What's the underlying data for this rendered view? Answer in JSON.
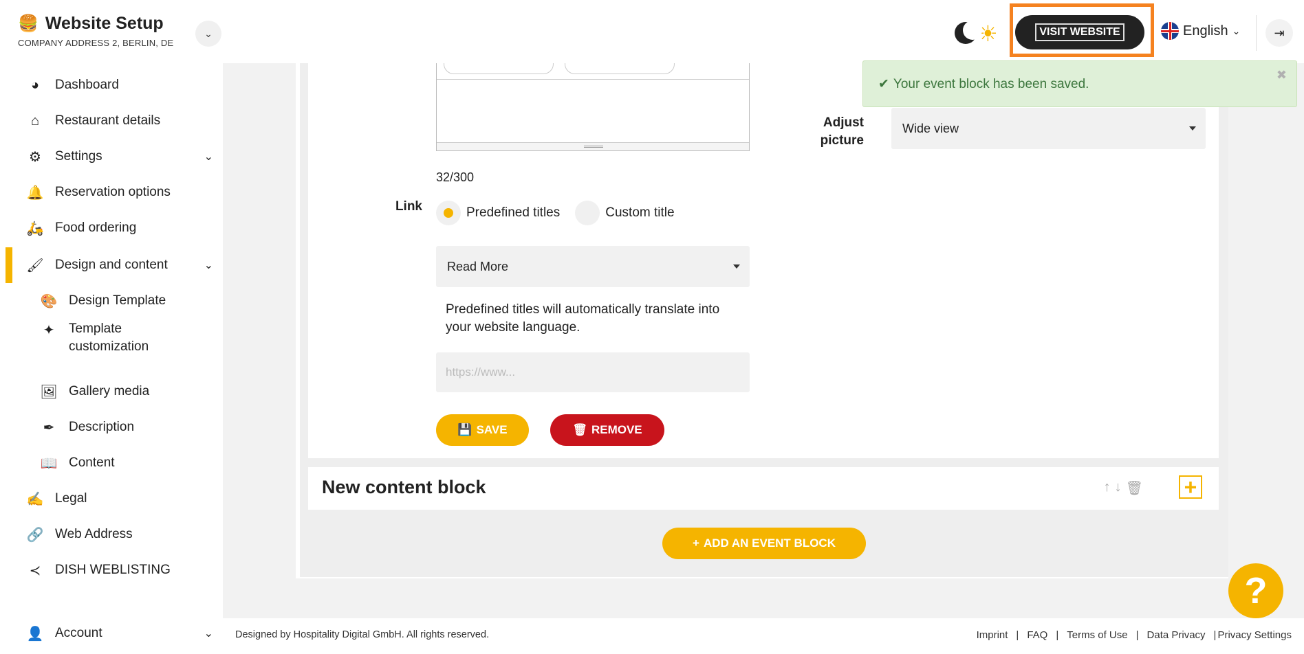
{
  "header": {
    "title": "Website Setup",
    "subtitle": "COMPANY ADDRESS 2, BERLIN, DE",
    "visit_label": "VISIT WEBSITE",
    "language": "English"
  },
  "sidebar": {
    "items": [
      {
        "label": "Dashboard",
        "icon": "dashboard-icon"
      },
      {
        "label": "Restaurant details",
        "icon": "home-icon"
      },
      {
        "label": "Settings",
        "icon": "gear-icon"
      },
      {
        "label": "Reservation options",
        "icon": "bell-icon"
      },
      {
        "label": "Food ordering",
        "icon": "food-ordering-icon"
      },
      {
        "label": "Design and content",
        "icon": "brush-icon"
      },
      {
        "label": "Design Template",
        "icon": "palette-icon"
      },
      {
        "label": "Template customization",
        "icon": "customize-icon"
      },
      {
        "label": "Gallery media",
        "icon": "gallery-icon"
      },
      {
        "label": "Description",
        "icon": "pen-icon"
      },
      {
        "label": "Content",
        "icon": "book-icon"
      },
      {
        "label": "Legal",
        "icon": "legal-icon"
      },
      {
        "label": "Web Address",
        "icon": "link-icon"
      },
      {
        "label": "DISH WEBLISTING",
        "icon": "share-icon"
      },
      {
        "label": "Account",
        "icon": "user-icon"
      }
    ]
  },
  "form": {
    "char_count": "32/300",
    "link_label": "Link",
    "radio_predefined": "Predefined titles",
    "radio_custom": "Custom title",
    "link_select_value": "Read More",
    "hint": "Predefined titles will automatically translate into your website language.",
    "url_placeholder": "https://www...",
    "save_label": "SAVE",
    "remove_label": "REMOVE",
    "adjust_label": "Adjust picture",
    "adjust_value": "Wide view"
  },
  "block": {
    "title": "New content block",
    "add_event_label": "ADD AN EVENT BLOCK"
  },
  "toast": {
    "message": "Your event block has been saved."
  },
  "footer": {
    "copyright": "Designed by Hospitality Digital GmbH. All rights reserved.",
    "links": [
      "Imprint",
      "FAQ",
      "Terms of Use",
      "Data Privacy",
      "Privacy Settings"
    ]
  },
  "colors": {
    "accent": "#f5b400",
    "danger": "#c8141c",
    "highlight": "#f58220",
    "success_bg": "#dff0d8"
  }
}
